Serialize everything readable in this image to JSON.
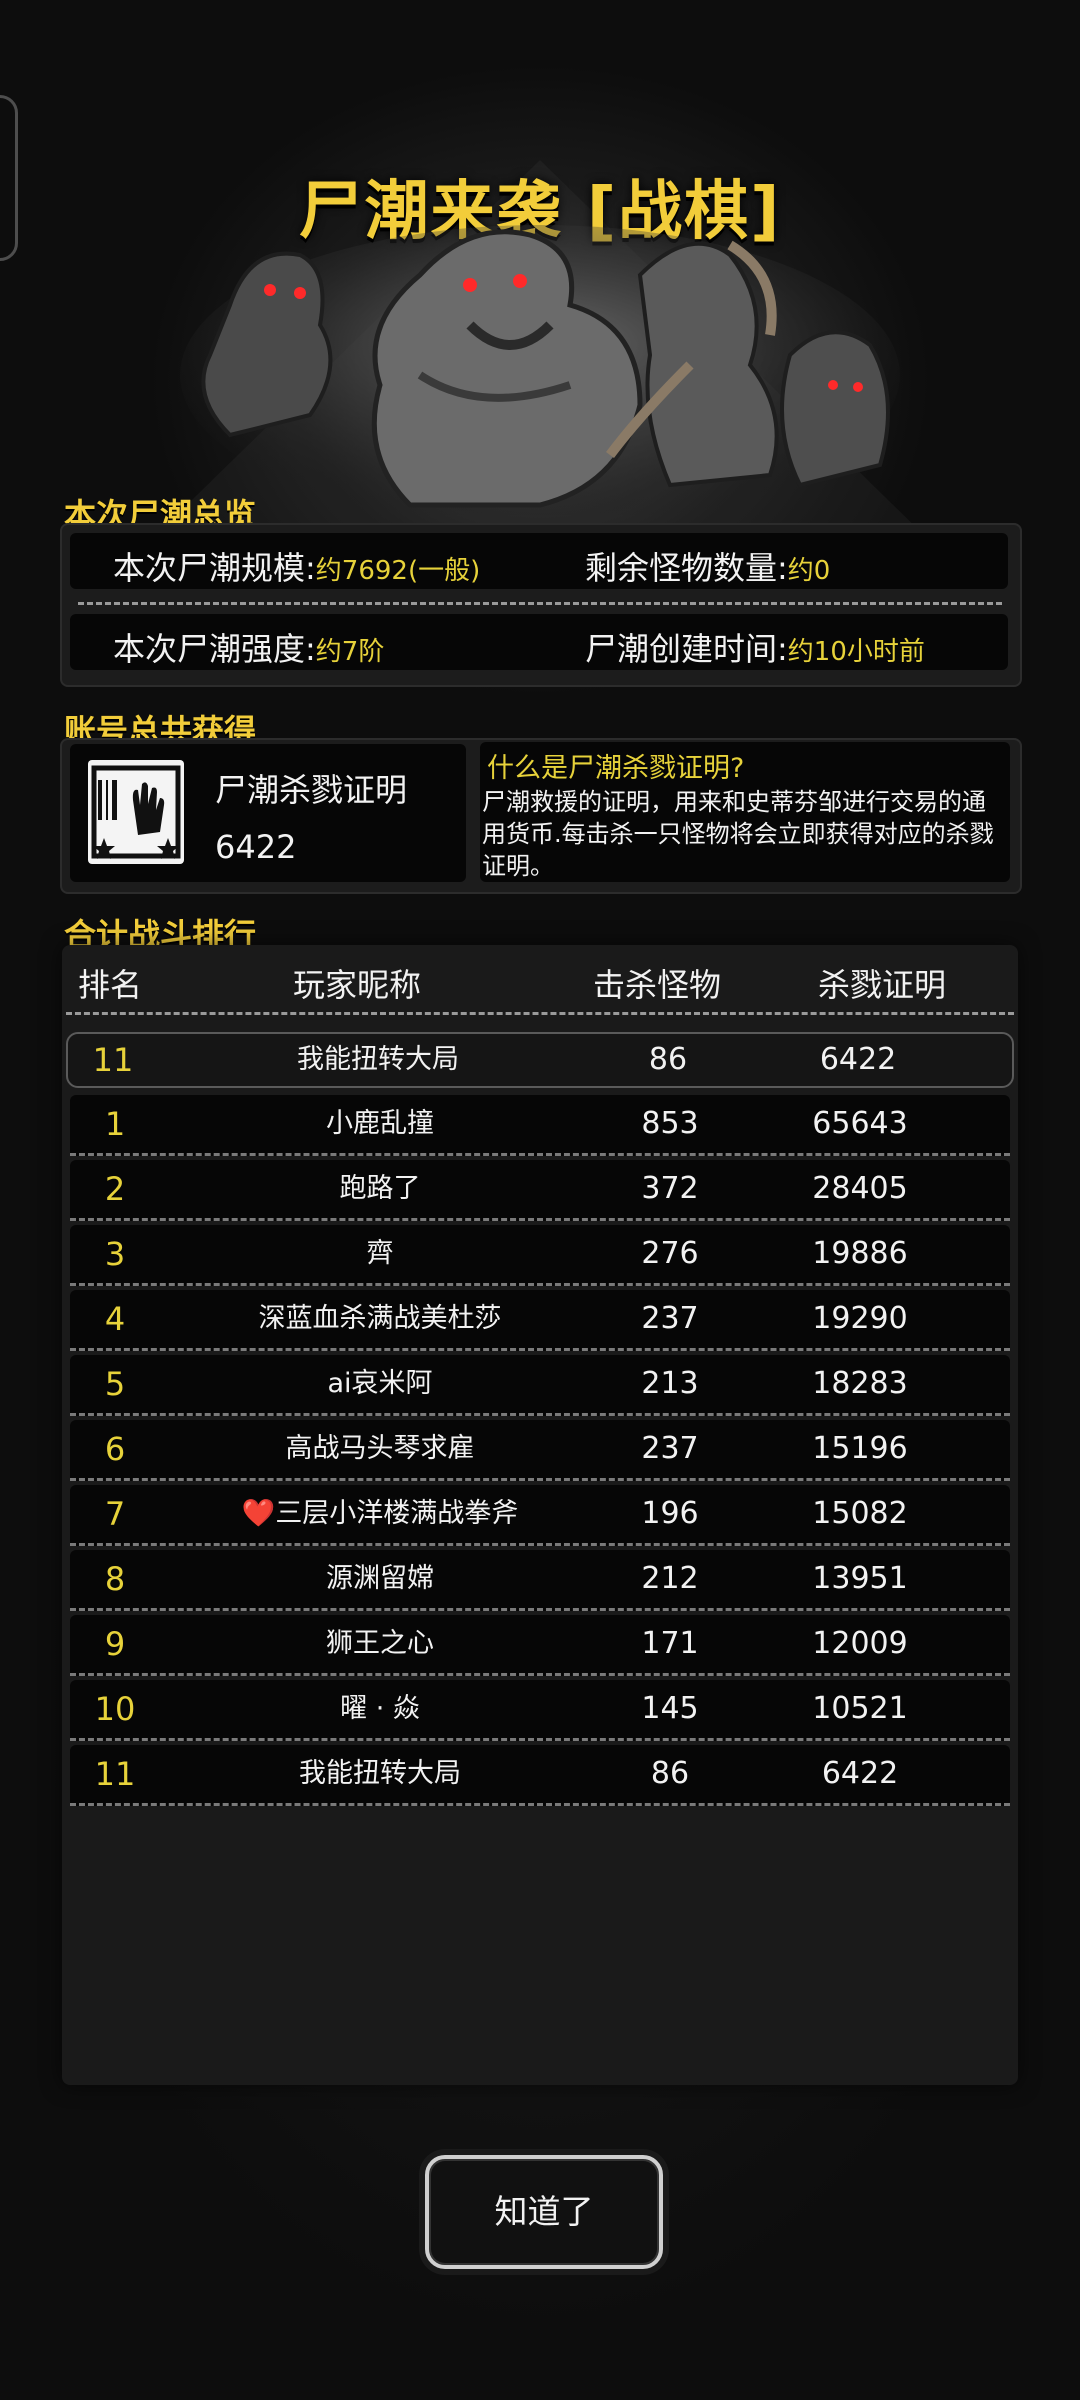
{
  "title": "尸潮来袭 [战棋]",
  "overview": {
    "label": "本次尸潮总览",
    "scale_key": "本次尸潮规模:",
    "scale_val": "约7692(一般)",
    "remaining_key": "剩余怪物数量:",
    "remaining_val": "约0",
    "strength_key": "本次尸潮强度:",
    "strength_val": "约7阶",
    "created_key": "尸潮创建时间:",
    "created_val": "约10小时前"
  },
  "account": {
    "label": "账号总共获得",
    "cert_name": "尸潮杀戮证明",
    "cert_value": "6422",
    "info_title": "什么是尸潮杀戮证明?",
    "info_body": "尸潮救援的证明，用来和史蒂芬邹进行交易的通用货币.每击杀一只怪物将会立即获得对应的杀戮证明。"
  },
  "ranking": {
    "label": "合计战斗排行",
    "headers": {
      "rank": "排名",
      "name": "玩家昵称",
      "kills": "击杀怪物",
      "cert": "杀戮证明"
    },
    "me": {
      "rank": "11",
      "name": "我能扭转大局",
      "kills": "86",
      "cert": "6422"
    },
    "rows": [
      {
        "rank": "1",
        "name": "小鹿乱撞",
        "kills": "853",
        "cert": "65643"
      },
      {
        "rank": "2",
        "name": "跑路了",
        "kills": "372",
        "cert": "28405"
      },
      {
        "rank": "3",
        "name": "齊",
        "kills": "276",
        "cert": "19886"
      },
      {
        "rank": "4",
        "name": "深蓝血杀满战美杜莎",
        "kills": "237",
        "cert": "19290"
      },
      {
        "rank": "5",
        "name": "ai哀米阿",
        "kills": "213",
        "cert": "18283"
      },
      {
        "rank": "6",
        "name": "高战马头琴求雇",
        "kills": "237",
        "cert": "15196"
      },
      {
        "rank": "7",
        "name": "三层小洋楼满战拳斧",
        "heart": "❤️",
        "kills": "196",
        "cert": "15082"
      },
      {
        "rank": "8",
        "name": "源渊留嫦",
        "kills": "212",
        "cert": "13951"
      },
      {
        "rank": "9",
        "name": "狮王之心",
        "kills": "171",
        "cert": "12009"
      },
      {
        "rank": "10",
        "name": "曜 · 焱",
        "kills": "145",
        "cert": "10521"
      },
      {
        "rank": "11",
        "name": "我能扭转大局",
        "kills": "86",
        "cert": "6422"
      }
    ]
  },
  "ok_button": "知道了"
}
